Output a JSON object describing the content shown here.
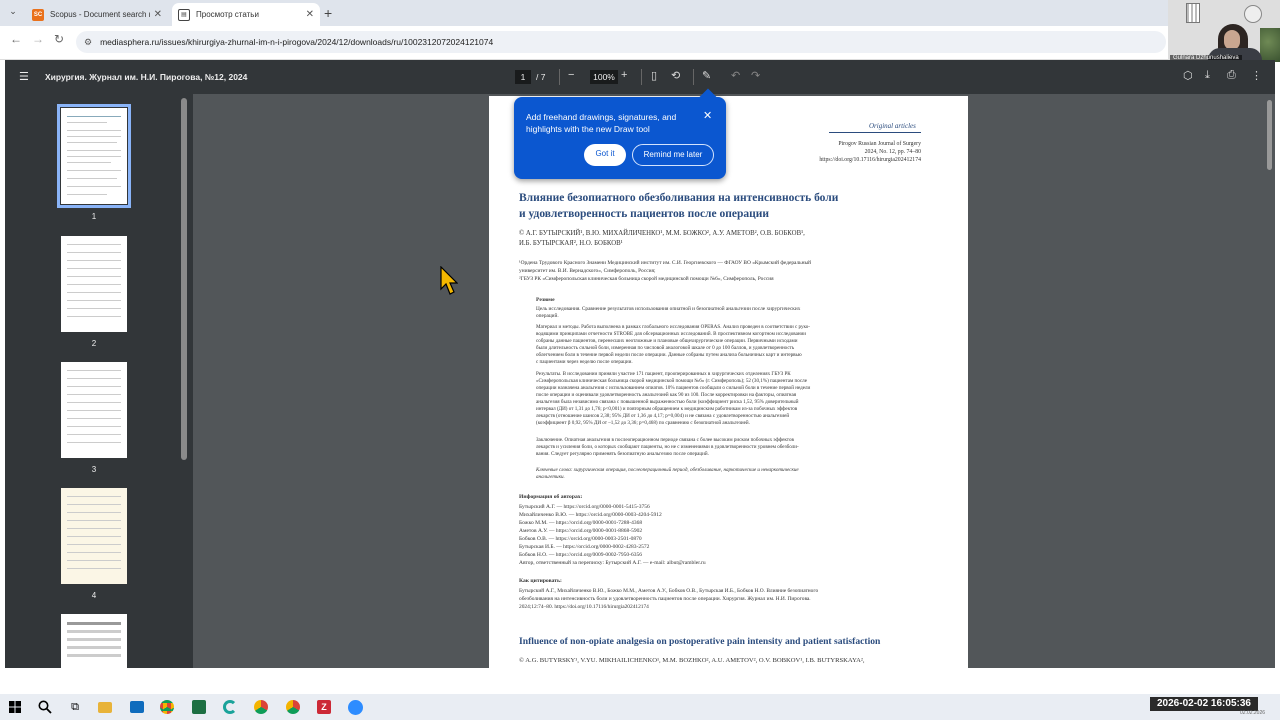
{
  "browser": {
    "tabs": [
      {
        "title": "Scopus - Document search res",
        "favicon": "SC",
        "color": "#e9711c"
      },
      {
        "title": "Просмотр статьи",
        "favicon": "",
        "color": "#444"
      }
    ],
    "url": "mediasphera.ru/issues/khirurgiya-zhurnal-im-n-i-pirogova/2024/12/downloads/ru/1002312072024121074"
  },
  "webcam": {
    "name": "Gulnara Dzhunushalieva"
  },
  "pdf": {
    "title": "Хирургия. Журнал им. Н.И. Пирогова, №12, 2024",
    "page": "1",
    "total": "/  7",
    "zoom": "100%",
    "thumbnails": [
      "1",
      "2",
      "3",
      "4"
    ]
  },
  "popup": {
    "message": "Add freehand drawings, signatures, and highlights with the new Draw tool",
    "got_it": "Got it",
    "remind": "Remind me later"
  },
  "article": {
    "section": "Original articles",
    "journal": "Pirogov Russian Journal of Surgery",
    "issue": "2024, No. 12, pp. 74–80",
    "doi": "https://doi.org/10.17116/hirurgia202412174",
    "title_ru_1": "Влияние безопиатного обезболивания на интенсивность боли",
    "title_ru_2": "и удовлетворенность пациентов после операции",
    "authors_1": "© А.Г. БУТЫРСКИЙ¹, В.Ю. МИХАЙЛИЧЕНКО¹, М.М. БОЖКО², А.У. АМЕТОВ², О.В. БОБКОВ¹,",
    "authors_2": "И.Б. БУТЫРСКАЯ², Н.О. БОБКОВ¹",
    "affil_1": "¹Ордена Трудового Красного Знамени Медицинский институт им. С.И. Георгиевского — ФГАОУ ВО «Крымский федеральный",
    "affil_2": "университет им. В.И. Вернадского», Симферополь, Россия;",
    "affil_3": "²ГБУЗ РК «Симферопольская клиническая больница скорой медицинской помощи №6», Симферополь, Россия",
    "abstract_head": "Резюме",
    "aim": "Цель исследования. Сравнение результатов использования опиатной и безопиатной анальгезии после хирургических",
    "aim_2": "операций.",
    "methods": [
      "Материал и методы. Работа выполнена в рамках глобального исследования OPERAS. Анализ проведен в соответствии с руко-",
      "водящими принципами отчетности STROBE для обсервационных исследований. В проспективном когортном исследовании",
      "собраны данные пациентов, перенесших неотложные и плановые общехирургические операции. Первичными исходами",
      "были длительность сильной боли, измеренная по числовой аналоговой шкале от 0 до 100 баллов, и удовлетворенность",
      "облегчением боли в течение первой недели после операции. Данные собраны путем анализа больничных карт и интервью",
      "с пациентами через неделю после операции."
    ],
    "results": [
      "Результаты. В исследовании приняли участие 171 пациент, прооперированных в хирургических отделениях ГБУЗ РК",
      "«Симферопольская клиническая больница скорой медицинской помощи №6» (г. Симферополь); 52 (30,1%) пациентам после",
      "операции назначена анальгезия с использованием опиатов. 10% пациентов сообщали о сильной боли в течение первой недели",
      "после операции и оценивали удовлетворенность анальгезией как 90 из 100. После корректировки на факторы, опиатная",
      "анальгезия была независимо связана с повышенной выраженностью боли (коэффициент риска 1,52, 95% доверительный",
      "интервал (ДИ) от 1,31 до 1,76; p<0,001) и повторным обращением к медицинским работникам из-за побочных эффектов",
      "лекарств (отношение шансов 2,38; 95% ДИ от 1,36 до 4,17; p=0,004) и не связана с удовлетворенностью анальгезией",
      "(коэффициент β 0,92, 95% ДИ от –1,52 до 3,36; p=0,468) по сравнению с безопиатной анальгезией."
    ],
    "conclusion": [
      "Заключение. Опиатная анальгезия в послеоперационном периоде связана с более высоким риском побочных эффектов",
      "лекарств и усиления боли, о которых сообщают пациенты, но не с изменениями в удовлетворенности уровнем обезболи-",
      "вания. Следует регулярно применять безопиатную анальгезию после операций."
    ],
    "keywords": [
      "Ключевые слова: хирургическая операция, послеоперационный период, обезболивание, наркотические и ненаркотические",
      "анальгетики."
    ],
    "info_head": "Информация об авторах:",
    "orcids": [
      "Бутырский А.Г. — https://orcid.org/0000-0001-5415-3756",
      "Михайличенко В.Ю. — https://orcid.org/0000-0003-4204-5912",
      "Божко М.М. — https://orcid.org/0000-0001-7288-4368",
      "Аметов А.У. — https://orcid.org/0000-0001-8868-5902",
      "Бобков О.В. — https://orcid.org/0000-0003-2501-0870",
      "Бутырская И.Б. — https://orcid.org/0000-0002-4283-2572",
      "Бобков Н.О. — https://orcid.org/0009-0002-7950-6356"
    ],
    "correspondence": "Автор, ответственный за переписку: Бутырский А.Г. — e-mail: albut@rambler.ru",
    "cite_head": "Как цитировать:",
    "cite": [
      "Бутырский А.Г., Михайличенко В.Ю., Божко М.М., Аметов А.У., Бобков О.В., Бутырская И.Б., Бобков Н.О. Влияние безопиатного",
      "обезболивания на интенсивность боли и удовлетворенность пациентов после операции. Хирургия. Журнал им. Н.И. Пирогова.",
      "2024;12:74–80. https://doi.org/10.17116/hirurgia202412174"
    ],
    "title_en": "Influence of non-opiate analgesia on postoperative pain intensity and patient satisfaction",
    "authors_en": "© A.G. BUTYRSKY¹, V.YU. MIKHAILICHENKO¹, M.M. BOZHKO², A.U. AMETOV², O.V. BOBKOV¹, I.B. BUTYRSKAYA²,"
  },
  "taskbar": {
    "clock": "2026-02-02 16:05:36",
    "date_sub": "02.02.2026"
  }
}
